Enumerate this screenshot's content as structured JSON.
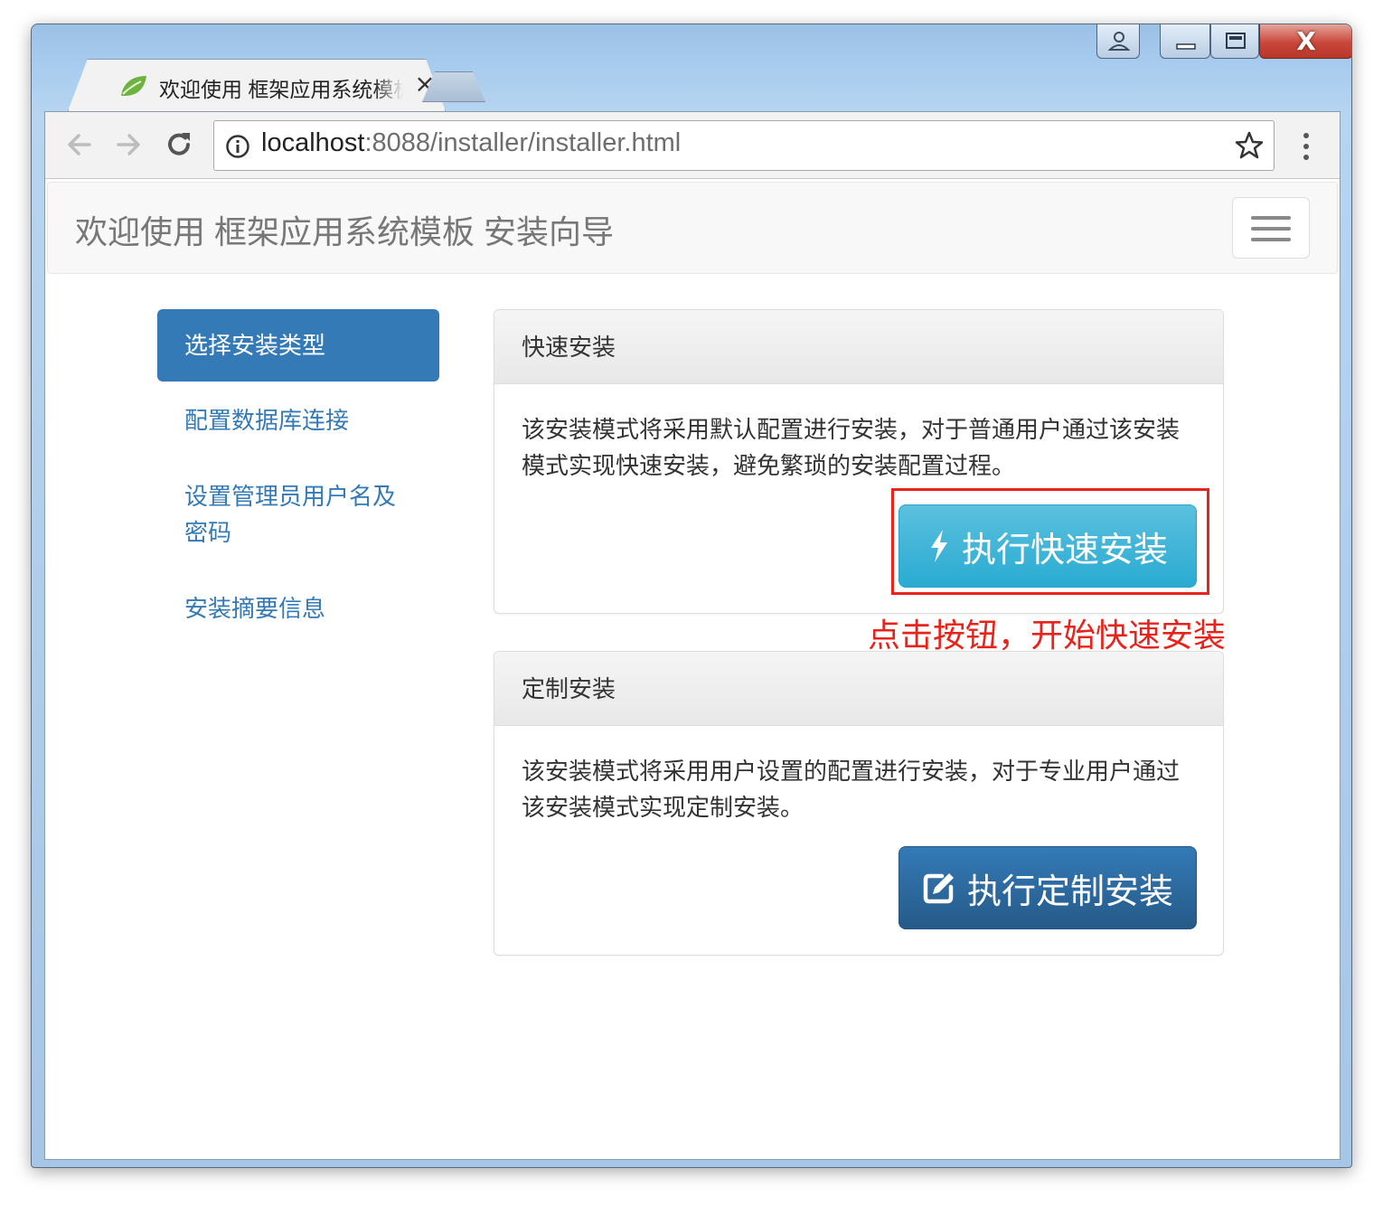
{
  "window": {
    "tab_title": "欢迎使用 框架应用系统模板 安装向导",
    "tab_close": "×",
    "close_glyph": "X"
  },
  "browser": {
    "url_host": "localhost",
    "url_rest": ":8088/installer/installer.html"
  },
  "page": {
    "brand": "欢迎使用 框架应用系统模板 安装向导",
    "sidebar": [
      {
        "label": "选择安装类型",
        "active": true
      },
      {
        "label": "配置数据库连接",
        "active": false
      },
      {
        "label": "设置管理员用户名及密码",
        "active": false
      },
      {
        "label": "安装摘要信息",
        "active": false
      }
    ],
    "quick_panel": {
      "heading": "快速安装",
      "body": "该安装模式将采用默认配置进行安装，对于普通用户通过该安装模式实现快速安装，避免繁琐的安装配置过程。",
      "button": "执行快速安装"
    },
    "custom_panel": {
      "heading": "定制安装",
      "body": "该安装模式将采用用户设置的配置进行安装，对于专业用户通过该安装模式实现定制安装。",
      "button": "执行定制安装"
    },
    "annotation": "点击按钮，开始快速安装"
  },
  "colors": {
    "primary": "#337ab7",
    "info": "#5bc0de",
    "annotation": "#e8231b"
  }
}
